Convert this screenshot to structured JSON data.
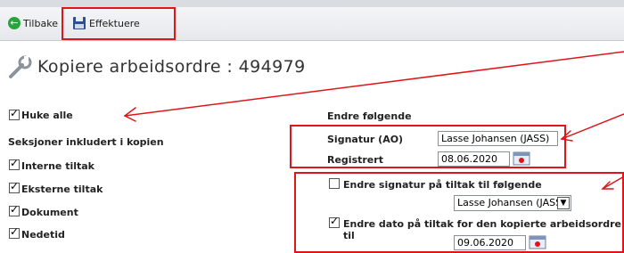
{
  "toolbar": {
    "back_label": "Tilbake",
    "execute_label": "Effektuere"
  },
  "page": {
    "title": "Kopiere arbeidsordre : 494979"
  },
  "left": {
    "check_all": {
      "label": "Huke alle",
      "checked": true
    },
    "sections_heading": "Seksjoner inkludert i kopien",
    "sections": [
      {
        "label": "Interne tiltak",
        "checked": true
      },
      {
        "label": "Eksterne tiltak",
        "checked": true
      },
      {
        "label": "Dokument",
        "checked": true
      },
      {
        "label": "Nedetid",
        "checked": true
      }
    ]
  },
  "right": {
    "heading": "Endre følgende",
    "signature": {
      "label": "Signatur (AO)",
      "value": "Lasse Johansen (JASS)"
    },
    "registered": {
      "label": "Registrert",
      "value": "08.06.2020"
    },
    "change_signature": {
      "label": "Endre signatur på tiltak til følgende",
      "checked": false,
      "selected": "Lasse Johansen (JASS)"
    },
    "change_date": {
      "label": "Endre dato på tiltak for den kopierte arbeidsordre til",
      "checked": true,
      "value": "09.06.2020"
    }
  },
  "colors": {
    "annotation": "#e0151a",
    "back_icon": "#2aa33b"
  },
  "icons": [
    "back-arrow-icon",
    "save-disk-icon",
    "wrench-icon",
    "calendar-icon",
    "chevron-down-icon"
  ]
}
